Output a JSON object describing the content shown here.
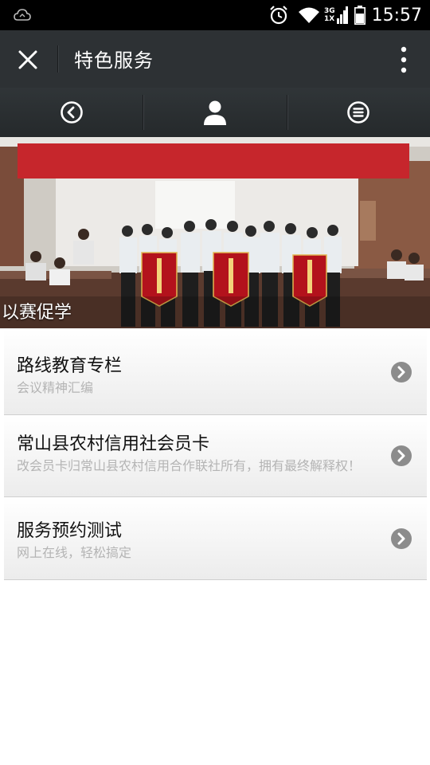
{
  "status_bar": {
    "time": "15:57",
    "network": [
      "3G",
      "1X"
    ],
    "icons": [
      "weather-icon",
      "alarm-icon",
      "wifi-icon",
      "signal-icon",
      "battery-icon"
    ]
  },
  "header": {
    "title": "特色服务",
    "icons": [
      "close-icon",
      "more-icon"
    ]
  },
  "toolbar": {
    "icons": [
      "back-circle-icon",
      "user-icon",
      "menu-circle-icon"
    ]
  },
  "banner": {
    "caption": "以赛促学"
  },
  "list": {
    "items": [
      {
        "title": "路线教育专栏",
        "desc": "会议精神汇编"
      },
      {
        "title": "常山县农村信用社会员卡",
        "desc": "改会员卡归常山县农村信用合作联社所有，拥有最终解释权！"
      },
      {
        "title": "服务预约测试",
        "desc": "网上在线，轻松搞定"
      }
    ]
  },
  "colors": {
    "title_bar": "#2d3134",
    "arrow": "#8c8c8c",
    "desc_text": "#b4b4b4"
  }
}
